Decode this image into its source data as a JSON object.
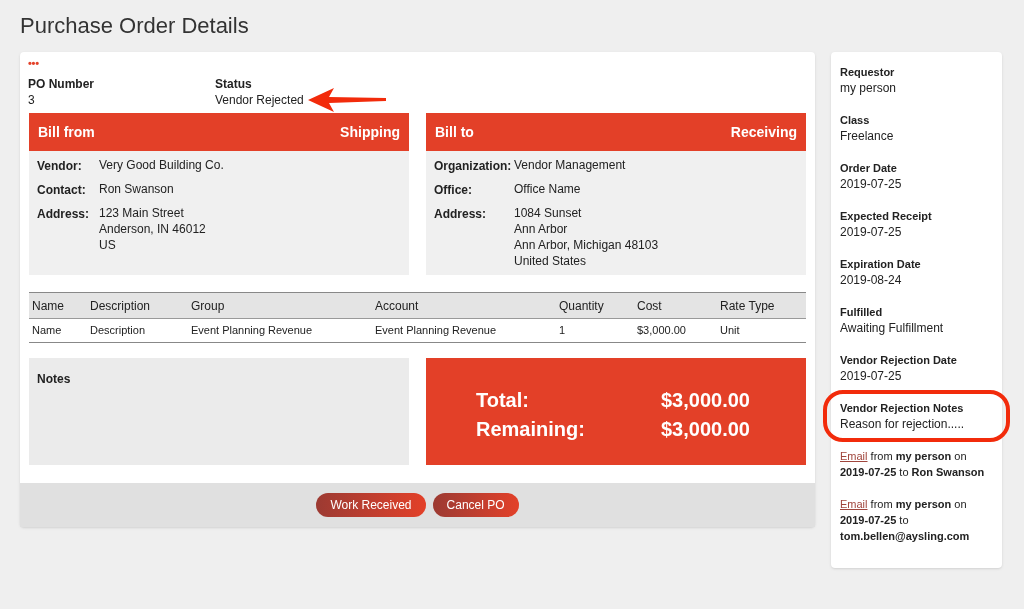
{
  "page_title": "Purchase Order Details",
  "menu_icon": "•••",
  "header_fields": [
    {
      "label": "PO Number",
      "value": "3"
    },
    {
      "label": "Status",
      "value": "Vendor Rejected"
    }
  ],
  "parties": [
    {
      "title": "Bill from",
      "subtitle": "Shipping",
      "rows": [
        {
          "label": "Vendor:",
          "lines": [
            "Very Good Building Co."
          ]
        },
        {
          "label": "Contact:",
          "lines": [
            "Ron Swanson"
          ]
        },
        {
          "label": "Address:",
          "lines": [
            "123 Main Street",
            "Anderson, IN 46012",
            "US"
          ]
        }
      ]
    },
    {
      "title": "Bill to",
      "subtitle": "Receiving",
      "rows": [
        {
          "label": "Organization:",
          "lines": [
            "Vendor Management"
          ]
        },
        {
          "label": "Office:",
          "lines": [
            "Office Name"
          ]
        },
        {
          "label": "Address:",
          "lines": [
            "1084 Sunset",
            "Ann Arbor",
            "Ann Arbor, Michigan 48103",
            "United States"
          ]
        }
      ]
    }
  ],
  "table": {
    "columns": [
      "Name",
      "Description",
      "Group",
      "Account",
      "Quantity",
      "Cost",
      "Rate Type"
    ],
    "rows": [
      [
        "Name",
        "Description",
        "Event Planning Revenue",
        "Event Planning Revenue",
        "1",
        "$3,000.00",
        "Unit"
      ]
    ]
  },
  "notes": {
    "label": "Notes"
  },
  "totals": [
    {
      "label": "Total:",
      "value": "$3,000.00"
    },
    {
      "label": "Remaining:",
      "value": "$3,000.00"
    }
  ],
  "buttons": [
    "Work Received",
    "Cancel PO"
  ],
  "sidebar": {
    "fields": [
      {
        "label": "Requestor",
        "value": "my person",
        "highlighted": false
      },
      {
        "label": "Class",
        "value": "Freelance",
        "highlighted": false
      },
      {
        "label": "Order Date",
        "value": "2019-07-25",
        "highlighted": false
      },
      {
        "label": "Expected Receipt",
        "value": "2019-07-25",
        "highlighted": false
      },
      {
        "label": "Expiration Date",
        "value": "2019-08-24",
        "highlighted": false
      },
      {
        "label": "Fulfilled",
        "value": "Awaiting Fulfillment",
        "highlighted": false
      },
      {
        "label": "Vendor Rejection Date",
        "value": "2019-07-25",
        "highlighted": false
      },
      {
        "label": "Vendor Rejection Notes",
        "value": "Reason for rejection.....",
        "highlighted": true
      }
    ],
    "log": [
      {
        "link": "Email",
        "text": " from **my person** on **2019-07-25** to **Ron Swanson**"
      },
      {
        "link": "Email",
        "text": " from **my person** on **2019-07-25** to **tom.bellen@aysling.com**"
      }
    ]
  }
}
